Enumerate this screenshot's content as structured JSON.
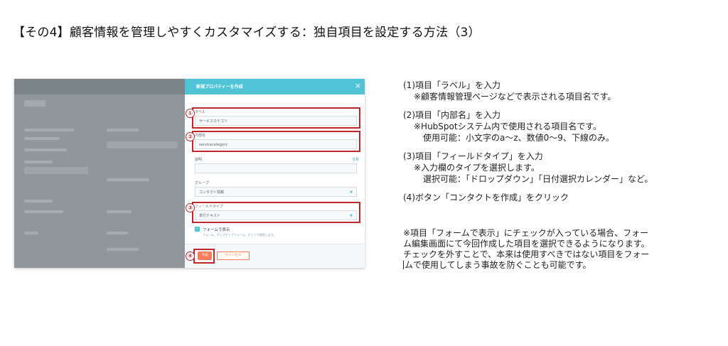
{
  "page": {
    "title": "【その4】顧客情報を管理しやすくカスタマイズする：独自項目を設定する方法（3）"
  },
  "modal": {
    "title": "新規プロパティーを作成",
    "close_icon": "×",
    "fields": [
      {
        "label": "ラベル",
        "value": ""
      },
      {
        "label": "内部名",
        "value": ""
      },
      {
        "label": "説明",
        "value": ""
      },
      {
        "label": "グループ",
        "value": "コンタクト情報"
      },
      {
        "label": "フィールドタイプ",
        "value": "単行テキスト"
      }
    ],
    "label_input_value": "サービスカテゴリ",
    "internal_name_value": "servicecategory",
    "description_corner": "任意",
    "checkbox": {
      "label": "フォームで表示",
      "sublabel": "フォーム、ポップアップフォーム、ボットで使用します。",
      "checked": true
    },
    "buttons": {
      "create": "作成",
      "cancel": "キャンセル"
    },
    "markers": [
      "①",
      "②",
      "③",
      "④"
    ],
    "accent_color": "#4fc4d6",
    "highlight_color": "#c0272d",
    "button_color": "#ff7a59"
  },
  "notes": {
    "step1": {
      "title": "(1)項目「ラベル」を入力",
      "lines": [
        "※顧客情報管理ページなどで表示される項目名です。"
      ]
    },
    "step2": {
      "title": "(2)項目「内部名」を入力",
      "lines": [
        "※HubSpotシステム内で使用される項目名です。",
        "使用可能：小文字のa～z、数値0～9、下線のみ。"
      ]
    },
    "step3": {
      "title": "(3)項目「フィールドタイプ」を入力",
      "lines": [
        "※入力欄のタイプを選択します。",
        "選択可能：「ドロップダウン」「日付選択カレンダー」など。"
      ]
    },
    "step4": {
      "title": "(4)ボタン「コンタクトを作成」をクリック"
    },
    "caution": [
      "※項目「フォームで表示」にチェックが入っている場合、フォー",
      "ム編集画面にて今回作成した項目を選択できるようになります。",
      "チェックを外すことで、本来は使用すべきではない項目をフォー",
      "ムで使用してしまう事故を防ぐことも可能です。"
    ]
  }
}
